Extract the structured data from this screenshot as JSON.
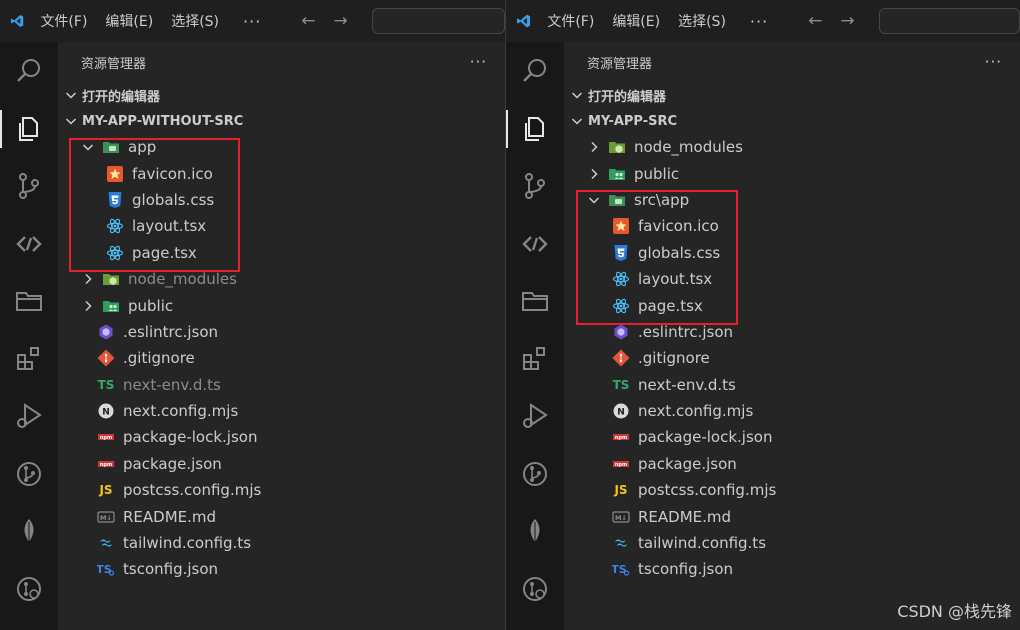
{
  "titlebar": {
    "menus": [
      "文件(F)",
      "编辑(E)",
      "选择(S)"
    ],
    "overflow": "···",
    "back_arrow": "←",
    "forward_arrow": "→"
  },
  "explorer": {
    "title": "资源管理器",
    "more": "···",
    "open_editors": "打开的编辑器"
  },
  "left": {
    "project": "MY-APP-WITHOUT-SRC",
    "items": [
      {
        "label": "app",
        "icon": "folder-app-icon",
        "kind": "folder-open"
      },
      {
        "label": "favicon.ico",
        "icon": "favicon-star-icon",
        "kind": "file"
      },
      {
        "label": "globals.css",
        "icon": "css3-icon",
        "kind": "file"
      },
      {
        "label": "layout.tsx",
        "icon": "react-icon",
        "kind": "file"
      },
      {
        "label": "page.tsx",
        "icon": "react-icon",
        "kind": "file"
      },
      {
        "label": "node_modules",
        "icon": "folder-node-icon",
        "kind": "folder"
      },
      {
        "label": "public",
        "icon": "folder-public-icon",
        "kind": "folder"
      },
      {
        "label": ".eslintrc.json",
        "icon": "eslint-icon",
        "kind": "file"
      },
      {
        "label": ".gitignore",
        "icon": "git-icon",
        "kind": "file"
      },
      {
        "label": "next-env.d.ts",
        "icon": "ts-text-icon",
        "kind": "file"
      },
      {
        "label": "next.config.mjs",
        "icon": "next-n-icon",
        "kind": "file"
      },
      {
        "label": "package-lock.json",
        "icon": "npm-icon",
        "kind": "file"
      },
      {
        "label": "package.json",
        "icon": "npm-icon",
        "kind": "file"
      },
      {
        "label": "postcss.config.mjs",
        "icon": "js-icon",
        "kind": "file"
      },
      {
        "label": "README.md",
        "icon": "markdown-icon",
        "kind": "file"
      },
      {
        "label": "tailwind.config.ts",
        "icon": "tailwind-icon",
        "kind": "file"
      },
      {
        "label": "tsconfig.json",
        "icon": "tsconfig-icon",
        "kind": "file"
      }
    ]
  },
  "right": {
    "project": "MY-APP-SRC",
    "items": [
      {
        "label": "node_modules",
        "icon": "folder-node-icon",
        "kind": "folder"
      },
      {
        "label": "public",
        "icon": "folder-public-icon",
        "kind": "folder"
      },
      {
        "label": "src\\app",
        "icon": "folder-app-icon",
        "kind": "folder-open"
      },
      {
        "label": "favicon.ico",
        "icon": "favicon-star-icon",
        "kind": "file"
      },
      {
        "label": "globals.css",
        "icon": "css3-icon",
        "kind": "file"
      },
      {
        "label": "layout.tsx",
        "icon": "react-icon",
        "kind": "file"
      },
      {
        "label": "page.tsx",
        "icon": "react-icon",
        "kind": "file"
      },
      {
        "label": ".eslintrc.json",
        "icon": "eslint-icon",
        "kind": "file"
      },
      {
        "label": ".gitignore",
        "icon": "git-icon",
        "kind": "file"
      },
      {
        "label": "next-env.d.ts",
        "icon": "ts-text-icon",
        "kind": "file"
      },
      {
        "label": "next.config.mjs",
        "icon": "next-n-icon",
        "kind": "file"
      },
      {
        "label": "package-lock.json",
        "icon": "npm-icon",
        "kind": "file"
      },
      {
        "label": "package.json",
        "icon": "npm-icon",
        "kind": "file"
      },
      {
        "label": "postcss.config.mjs",
        "icon": "js-icon",
        "kind": "file"
      },
      {
        "label": "README.md",
        "icon": "markdown-icon",
        "kind": "file"
      },
      {
        "label": "tailwind.config.ts",
        "icon": "tailwind-icon",
        "kind": "file"
      },
      {
        "label": "tsconfig.json",
        "icon": "tsconfig-icon",
        "kind": "file"
      }
    ]
  },
  "icon_text": {
    "ts": "TS",
    "js": "JS",
    "md": "M↓",
    "n": "N",
    "npm": "npm",
    "tsconf": "TS"
  },
  "colors": {
    "highlight_box": "#e5202e",
    "accent_blue": "#3b9fe8"
  },
  "watermark": "CSDN @栈先锋"
}
